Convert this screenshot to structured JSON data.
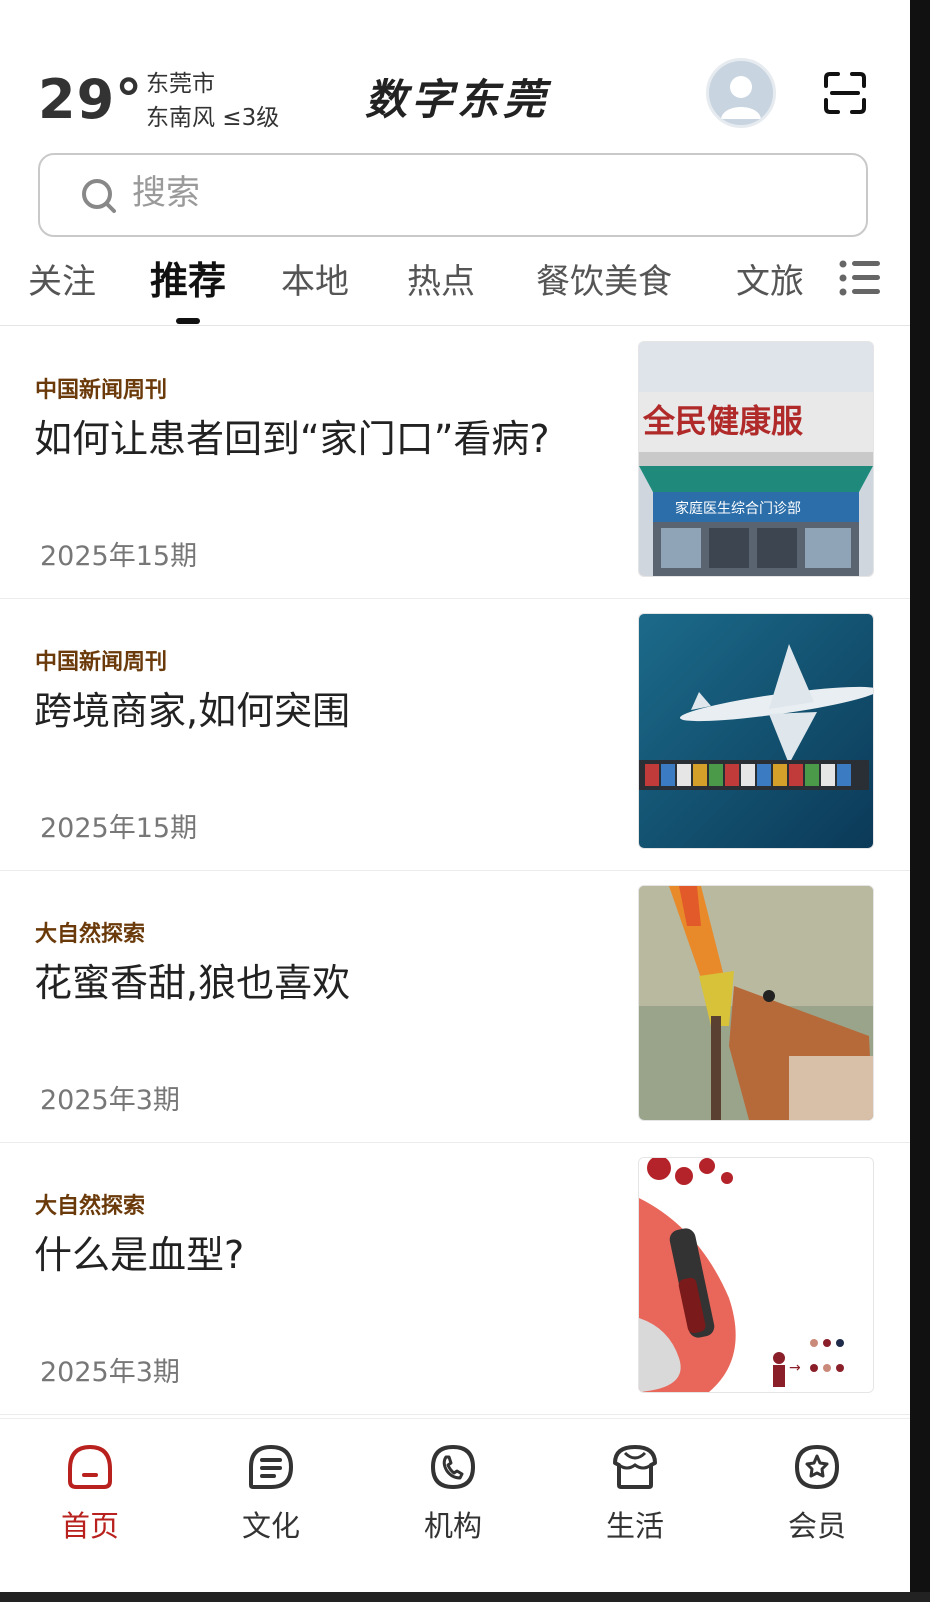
{
  "header": {
    "temperature": "29°",
    "city": "东莞市",
    "wind": "东南风 ≤3级",
    "logo": "数字东莞"
  },
  "search": {
    "placeholder": "搜索"
  },
  "tabs": [
    {
      "label": "关注",
      "active": false
    },
    {
      "label": "推荐",
      "active": true
    },
    {
      "label": "本地",
      "active": false
    },
    {
      "label": "热点",
      "active": false
    },
    {
      "label": "餐饮美食",
      "active": false
    },
    {
      "label": "文旅",
      "active": false
    }
  ],
  "feed": [
    {
      "source": "中国新闻周刊",
      "title": "如何让患者回到“家门口”看病?",
      "date": "2025年15期",
      "image": {
        "icon": "clinic-building-photo",
        "sign": "全民健康服",
        "door_sign": "家庭医生综合门诊部"
      }
    },
    {
      "source": "中国新闻周刊",
      "title": "跨境商家,如何突围",
      "date": "2025年15期",
      "image": {
        "icon": "airplane-over-cargo-ship-photo"
      }
    },
    {
      "source": "大自然探索",
      "title": "花蜜香甜,狼也喜欢",
      "date": "2025年3期",
      "image": {
        "icon": "wolf-licking-flower-photo"
      }
    },
    {
      "source": "大自然探索",
      "title": "什么是血型?",
      "date": "2025年3期",
      "image": {
        "icon": "blood-sample-illustration"
      }
    }
  ],
  "bottom_nav": [
    {
      "label": "首页",
      "icon": "home-icon",
      "active": true
    },
    {
      "label": "文化",
      "icon": "culture-icon",
      "active": false
    },
    {
      "label": "机构",
      "icon": "organization-icon",
      "active": false
    },
    {
      "label": "生活",
      "icon": "life-icon",
      "active": false
    },
    {
      "label": "会员",
      "icon": "member-icon",
      "active": false
    }
  ],
  "colors": {
    "accent": "#b8211d",
    "source_text": "#6b3a0a"
  }
}
